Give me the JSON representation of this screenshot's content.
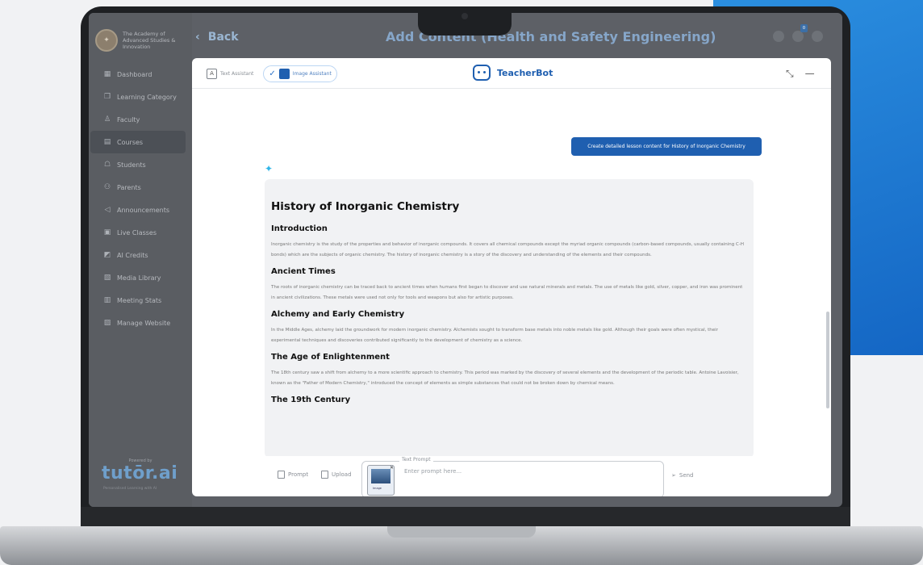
{
  "sidebar": {
    "school_name": "The Academy of Advanced Studies & Innovation",
    "items": [
      {
        "label": "Dashboard",
        "icon": "grid-icon"
      },
      {
        "label": "Learning Category",
        "icon": "category-icon"
      },
      {
        "label": "Faculty",
        "icon": "person-icon"
      },
      {
        "label": "Courses",
        "icon": "book-icon",
        "active": true
      },
      {
        "label": "Students",
        "icon": "student-icon"
      },
      {
        "label": "Parents",
        "icon": "parents-icon"
      },
      {
        "label": "Announcements",
        "icon": "megaphone-icon"
      },
      {
        "label": "Live Classes",
        "icon": "video-icon"
      },
      {
        "label": "AI Credits",
        "icon": "credits-icon"
      },
      {
        "label": "Media Library",
        "icon": "media-icon"
      },
      {
        "label": "Meeting Stats",
        "icon": "stats-icon"
      },
      {
        "label": "Manage Website",
        "icon": "website-icon"
      }
    ],
    "powered_by": "Powered by",
    "brand": "tutōr.ai",
    "brand_tagline": "Personalised Learning with AI"
  },
  "header": {
    "back_label": "Back",
    "title": "Add Content (Health and Safety Engineering)",
    "notification_count": "0"
  },
  "assistant": {
    "tabs": [
      {
        "label": "Text Assistant",
        "active": false
      },
      {
        "label": "Image Assistant",
        "active": true
      }
    ],
    "brand_name": "TeacherBot"
  },
  "chat": {
    "user_message": "Create detailed lesson content for History of Inorganic Chemistry",
    "answer": {
      "title": "History of Inorganic Chemistry",
      "sections": [
        {
          "heading": "Introduction",
          "body": "Inorganic chemistry is the study of the properties and behavior of inorganic compounds. It covers all chemical compounds except the myriad organic compounds (carbon-based compounds, usually containing C-H bonds) which are the subjects of organic chemistry. The history of inorganic chemistry is a story of the discovery and understanding of the elements and their compounds."
        },
        {
          "heading": "Ancient Times",
          "body": "The roots of inorganic chemistry can be traced back to ancient times when humans first began to discover and use natural minerals and metals. The use of metals like gold, silver, copper, and iron was prominent in ancient civilizations. These metals were used not only for tools and weapons but also for artistic purposes."
        },
        {
          "heading": "Alchemy and Early Chemistry",
          "body": "In the Middle Ages, alchemy laid the groundwork for modern inorganic chemistry. Alchemists sought to transform base metals into noble metals like gold. Although their goals were often mystical, their experimental techniques and discoveries contributed significantly to the development of chemistry as a science."
        },
        {
          "heading": "The Age of Enlightenment",
          "body": "The 18th century saw a shift from alchemy to a more scientific approach to chemistry. This period was marked by the discovery of several elements and the development of the periodic table. Antoine Lavoisier, known as the \"Father of Modern Chemistry,\" introduced the concept of elements as simple substances that could not be broken down by chemical means."
        },
        {
          "heading": "The 19th Century",
          "body": ""
        }
      ]
    }
  },
  "composer": {
    "prompt_label": "Prompt",
    "upload_label": "Upload",
    "legend": "Text Prompt",
    "placeholder": "Enter prompt here...",
    "send_label": "Send",
    "attachment_caption": "Image"
  }
}
